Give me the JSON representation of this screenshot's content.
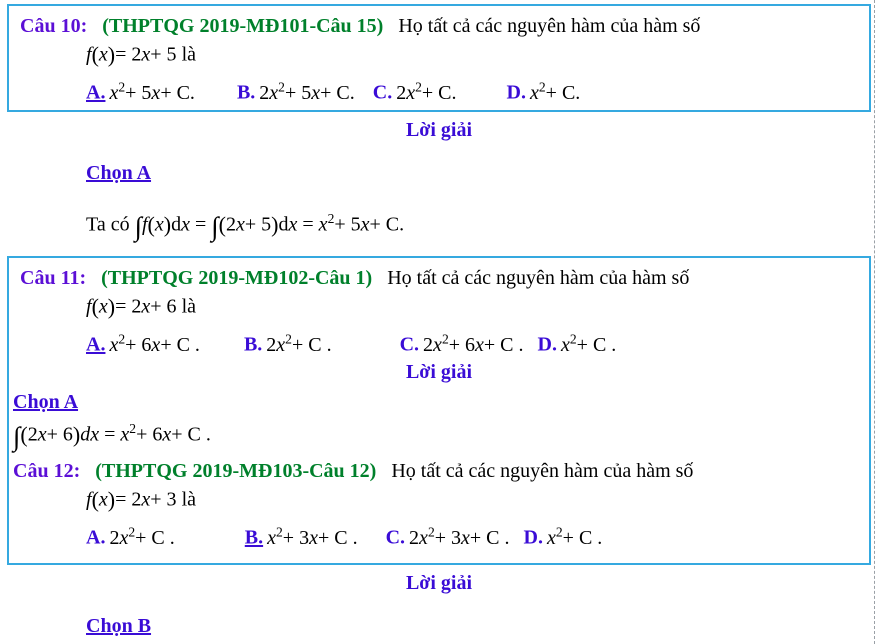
{
  "document": {
    "type": "vietnamese-math-exam-solutions",
    "topic": "Nguyên hàm"
  },
  "colors": {
    "box_border": "#35a9e0",
    "question_label": "#5b0fd6",
    "question_source": "#00802b",
    "option_letter": "#3a0cd6",
    "solution_heading": "#3a0cd6",
    "body_text": "#000000",
    "page_guide": "#9aa0a6"
  },
  "questions": [
    {
      "label": "Câu 10:",
      "source": "(THPTQG 2019-MĐ101-Câu 15)",
      "prompt": "Họ tất cả các nguyên hàm của hàm số",
      "function_prefix": "f",
      "function_arg": "x",
      "function_body": "= 2x + 5",
      "function_suffix": "là",
      "options": [
        {
          "letter": "A.",
          "correct": true,
          "expr": "x² + 5x + C."
        },
        {
          "letter": "B.",
          "correct": false,
          "expr": "2x² + 5x + C."
        },
        {
          "letter": "C.",
          "correct": false,
          "expr": "2x² + C."
        },
        {
          "letter": "D.",
          "correct": false,
          "expr": "x² + C."
        }
      ],
      "solution_heading": "Lời giải",
      "chosen": "Chọn A",
      "work_prefix": "Ta có",
      "work": "∫ f(x)dx = ∫(2x + 5)dx = x² + 5x + C."
    },
    {
      "label": "Câu 11:",
      "source": "(THPTQG 2019-MĐ102-Câu 1)",
      "prompt": "Họ tất cả các nguyên hàm của hàm số",
      "function_prefix": "f",
      "function_arg": "x",
      "function_body": "= 2x + 6",
      "function_suffix": "là",
      "options": [
        {
          "letter": "A.",
          "correct": true,
          "expr": "x² + 6x + C."
        },
        {
          "letter": "B.",
          "correct": false,
          "expr": "2x² + C."
        },
        {
          "letter": "C.",
          "correct": false,
          "expr": "2x² + 6x + C."
        },
        {
          "letter": "D.",
          "correct": false,
          "expr": "x² + C."
        }
      ],
      "solution_heading": "Lời giải",
      "chosen": "Chọn A",
      "work_prefix": "",
      "work": "∫(2x + 6)dx = x² + 6x + C."
    },
    {
      "label": "Câu 12:",
      "source": "(THPTQG 2019-MĐ103-Câu 12)",
      "prompt": "Họ tất cả các nguyên hàm của hàm số",
      "function_prefix": "f",
      "function_arg": "x",
      "function_body": "= 2x + 3",
      "function_suffix": "là",
      "options": [
        {
          "letter": "A.",
          "correct": false,
          "expr": "2x² + C."
        },
        {
          "letter": "B.",
          "correct": true,
          "expr": "x² + 3x + C."
        },
        {
          "letter": "C.",
          "correct": false,
          "expr": "2x² + 3x + C."
        },
        {
          "letter": "D.",
          "correct": false,
          "expr": "x² + C."
        }
      ],
      "solution_heading": "Lời giải",
      "chosen": "Chọn B",
      "work_prefix": "",
      "work": ""
    }
  ],
  "q10": {
    "label": "Câu 10:",
    "source": "(THPTQG 2019-MĐ101-Câu 15)",
    "prompt": "Họ tất cả các nguyên hàm của hàm số",
    "fn_f": "f",
    "fn_open": "(",
    "fn_x": "x",
    "fn_close": ")",
    "fn_eq": "= 2",
    "fn_xvar": "x",
    "fn_plus": "+ 5",
    "fn_la": "là",
    "optA_letter": "A.",
    "optA_x": "x",
    "optA_rest": "+ 5",
    "optA_x2": "x",
    "optA_tail": "+ C.",
    "optB_letter": "B.",
    "optB_lead": "2",
    "optB_x": "x",
    "optB_rest": "+ 5",
    "optB_x2": "x",
    "optB_tail": "+ C.",
    "optC_letter": "C.",
    "optC_lead": "2",
    "optC_x": "x",
    "optC_tail": "+ C.",
    "optD_letter": "D.",
    "optD_x": "x",
    "optD_tail": "+ C.",
    "loigiai": "Lời giải",
    "chon": "Chọn A",
    "work_taco": "Ta có",
    "w_int1": "∫",
    "w_f": "f",
    "w_open": "(",
    "w_x": "x",
    "w_close": ")",
    "w_d": "d",
    "w_xd": "x",
    "w_eq1": "=",
    "w_int2": "∫",
    "w_open2": "(",
    "w_2": "2",
    "w_x2": "x",
    "w_p5": "+ 5",
    "w_close2": ")",
    "w_d2": "d",
    "w_xd2": "x",
    "w_eq2": "=",
    "w_xr": "x",
    "w_p5x": "+ 5",
    "w_xr2": "x",
    "w_tail": "+ C."
  },
  "q11": {
    "label": "Câu 11:",
    "source": "(THPTQG 2019-MĐ102-Câu 1)",
    "prompt": "Họ tất cả các nguyên hàm của hàm số",
    "fn_f": "f",
    "fn_open": "(",
    "fn_x": "x",
    "fn_close": ")",
    "fn_eq": "= 2",
    "fn_xvar": "x",
    "fn_plus": "+ 6",
    "fn_la": "là",
    "optA_letter": "A.",
    "optA_x": "x",
    "optA_rest": "+ 6",
    "optA_x2": "x",
    "optA_tail": "+ C .",
    "optB_letter": "B.",
    "optB_lead": "2",
    "optB_x": "x",
    "optB_tail": "+ C .",
    "optC_letter": "C.",
    "optC_lead": "2",
    "optC_x": "x",
    "optC_rest": "+ 6",
    "optC_x2": "x",
    "optC_tail": "+ C .",
    "optD_letter": "D.",
    "optD_x": "x",
    "optD_tail": "+ C .",
    "loigiai": "Lời giải",
    "chon": "Chọn A",
    "w_int": "∫",
    "w_open": "(",
    "w_2": "2",
    "w_x": "x",
    "w_p6": "+ 6",
    "w_close": ")",
    "w_d": "d",
    "w_xd": "x",
    "w_eq": "=",
    "w_xr": "x",
    "w_p6x": "+ 6",
    "w_xr2": "x",
    "w_tail": "+ C ."
  },
  "q12": {
    "label": "Câu 12:",
    "source": "(THPTQG 2019-MĐ103-Câu 12)",
    "prompt": "Họ tất cả các nguyên hàm của hàm số",
    "fn_f": "f",
    "fn_open": "(",
    "fn_x": "x",
    "fn_close": ")",
    "fn_eq": "= 2",
    "fn_xvar": "x",
    "fn_plus": "+ 3",
    "fn_la": "là",
    "optA_letter": "A.",
    "optA_lead": "2",
    "optA_x": "x",
    "optA_tail": "+ C .",
    "optB_letter": "B.",
    "optB_x": "x",
    "optB_rest": "+ 3",
    "optB_x2": "x",
    "optB_tail": "+ C .",
    "optC_letter": "C.",
    "optC_lead": "2",
    "optC_x": "x",
    "optC_rest": "+ 3",
    "optC_x2": "x",
    "optC_tail": "+ C .",
    "optD_letter": "D.",
    "optD_x": "x",
    "optD_tail": "+ C .",
    "loigiai": "Lời giải",
    "chon": "Chọn B"
  },
  "exponent": "2"
}
